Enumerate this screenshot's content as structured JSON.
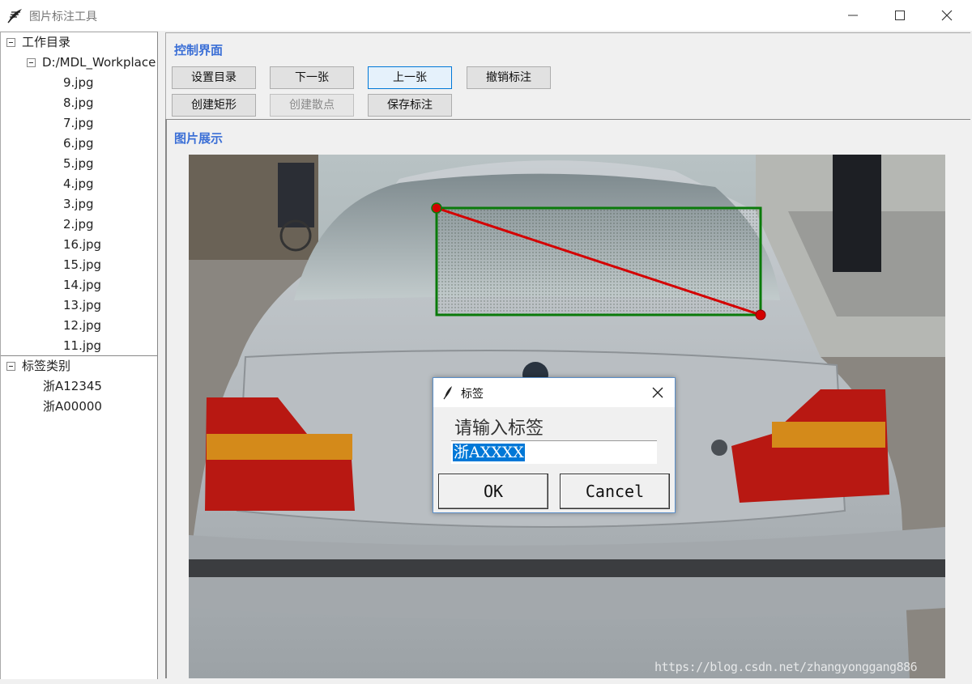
{
  "window": {
    "title": "图片标注工具"
  },
  "sidebar": {
    "folders": [
      {
        "label": "工作目录"
      },
      {
        "label": "D:/MDL_Workplace"
      }
    ],
    "files": [
      "9.jpg",
      "8.jpg",
      "7.jpg",
      "6.jpg",
      "5.jpg",
      "4.jpg",
      "3.jpg",
      "2.jpg",
      "16.jpg",
      "15.jpg",
      "14.jpg",
      "13.jpg",
      "12.jpg",
      "11.jpg"
    ],
    "label_group": "标签类别",
    "labels": [
      "浙A12345",
      "浙A00000"
    ]
  },
  "control": {
    "title": "控制界面",
    "buttons": {
      "set_dir": "设置目录",
      "next": "下一张",
      "prev": "上一张",
      "undo": "撤销标注",
      "create_rect": "创建矩形",
      "create_points": "创建散点",
      "save": "保存标注"
    }
  },
  "display": {
    "title": "图片展示"
  },
  "dialog": {
    "title": "标签",
    "prompt": "请输入标签",
    "value": "浙AXXXX",
    "ok": "OK",
    "cancel": "Cancel"
  },
  "watermark": "https://blog.csdn.net/zhangyonggang886",
  "colors": {
    "accent": "#3b6fd6",
    "annotation_box": "#0a7a0a",
    "annotation_line": "#d40000",
    "selection": "#0078d7"
  }
}
